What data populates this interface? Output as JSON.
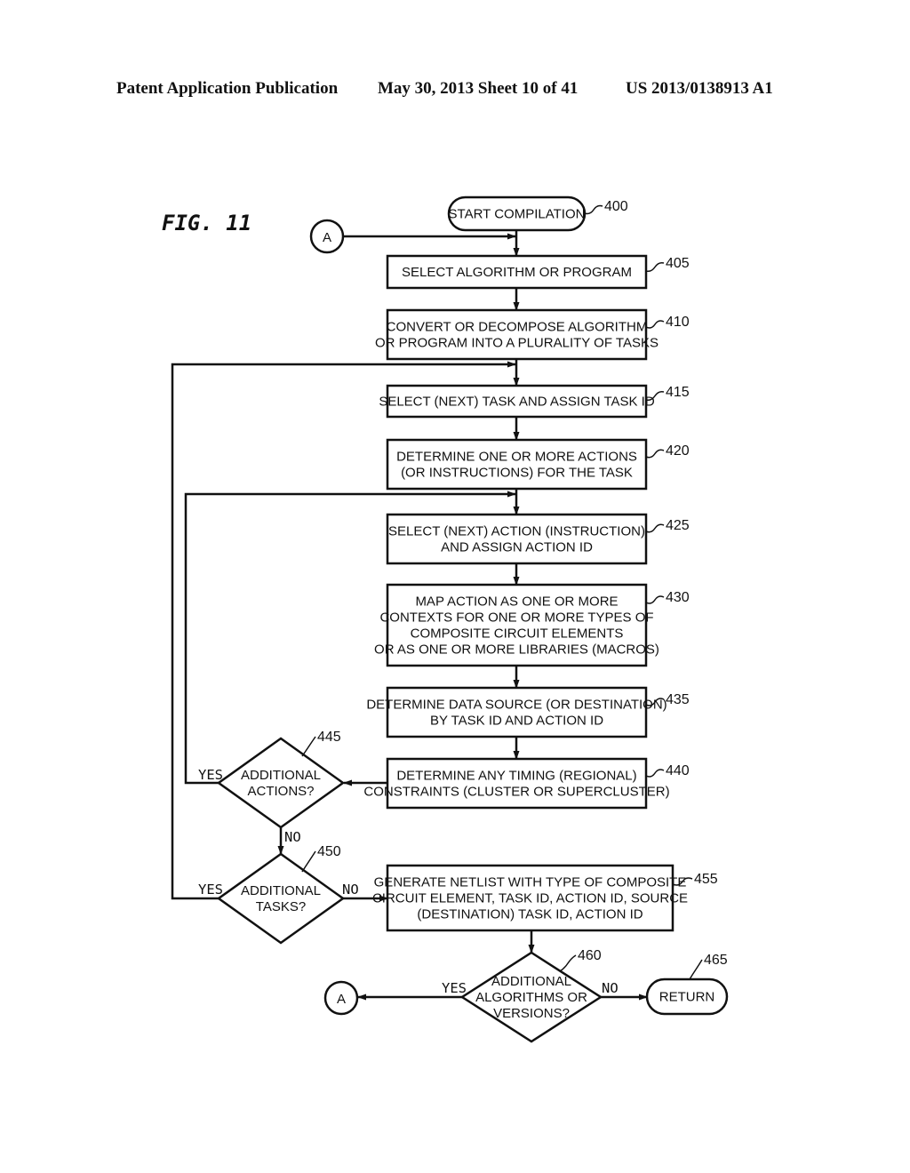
{
  "header": {
    "publication": "Patent Application Publication",
    "date_sheet": "May 30, 2013  Sheet 10 of 41",
    "number": "US 2013/0138913 A1"
  },
  "figure": {
    "label": "FIG. 11"
  },
  "connectors": {
    "a_top": "A",
    "a_bottom": "A"
  },
  "nodes": {
    "n400": {
      "ref": "400",
      "lines": [
        "START COMPILATION"
      ]
    },
    "n405": {
      "ref": "405",
      "lines": [
        "SELECT ALGORITHM OR PROGRAM"
      ]
    },
    "n410": {
      "ref": "410",
      "lines": [
        "CONVERT OR DECOMPOSE ALGORITHM",
        "OR PROGRAM INTO A PLURALITY OF TASKS"
      ]
    },
    "n415": {
      "ref": "415",
      "lines": [
        "SELECT (NEXT) TASK AND ASSIGN TASK ID"
      ]
    },
    "n420": {
      "ref": "420",
      "lines": [
        "DETERMINE ONE OR MORE ACTIONS",
        "(OR INSTRUCTIONS) FOR THE TASK"
      ]
    },
    "n425": {
      "ref": "425",
      "lines": [
        "SELECT (NEXT) ACTION (INSTRUCTION)",
        "AND ASSIGN ACTION ID"
      ]
    },
    "n430": {
      "ref": "430",
      "lines": [
        "MAP ACTION AS ONE OR MORE",
        "CONTEXTS FOR ONE OR MORE TYPES OF",
        "COMPOSITE CIRCUIT ELEMENTS",
        "OR AS ONE OR MORE LIBRARIES (MACROS)"
      ]
    },
    "n435": {
      "ref": "435",
      "lines": [
        "DETERMINE DATA SOURCE (OR DESTINATION)",
        "BY TASK ID AND ACTION ID"
      ]
    },
    "n440": {
      "ref": "440",
      "lines": [
        "DETERMINE ANY TIMING (REGIONAL)",
        "CONSTRAINTS (CLUSTER OR SUPERCLUSTER)"
      ]
    },
    "n445": {
      "ref": "445",
      "lines": [
        "ADDITIONAL",
        "ACTIONS?"
      ]
    },
    "n450": {
      "ref": "450",
      "lines": [
        "ADDITIONAL",
        "TASKS?"
      ]
    },
    "n455": {
      "ref": "455",
      "lines": [
        "GENERATE NETLIST WITH TYPE OF COMPOSITE",
        "CIRCUIT ELEMENT, TASK ID, ACTION ID, SOURCE",
        "(DESTINATION) TASK ID, ACTION ID"
      ]
    },
    "n460": {
      "ref": "460",
      "lines": [
        "ADDITIONAL",
        "ALGORITHMS OR",
        "VERSIONS?"
      ]
    },
    "n465": {
      "ref": "465",
      "lines": [
        "RETURN"
      ]
    }
  },
  "edge_labels": {
    "e445_yes": "YES",
    "e445_no": "NO",
    "e450_yes": "YES",
    "e450_no": "NO",
    "e460_yes": "YES",
    "e460_no": "NO"
  }
}
